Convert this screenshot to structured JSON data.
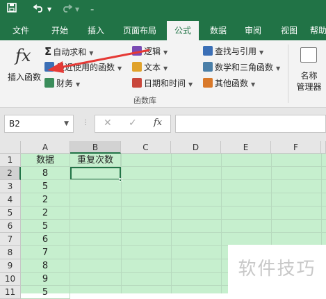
{
  "quick_access": {
    "save_icon": "save-icon",
    "undo_icon": "undo-icon",
    "redo_icon": "redo-icon",
    "customize_icon": "customize-icon"
  },
  "tabs": [
    {
      "label": "文件"
    },
    {
      "label": "开始"
    },
    {
      "label": "插入"
    },
    {
      "label": "页面布局"
    },
    {
      "label": "公式"
    },
    {
      "label": "数据"
    },
    {
      "label": "审阅"
    },
    {
      "label": "视图"
    },
    {
      "label": "帮助"
    }
  ],
  "ribbon": {
    "insert_function": {
      "icon_text": "fx",
      "label": "插入函数"
    },
    "autosum": "自动求和",
    "recent": "最近使用的函数",
    "financial": "财务",
    "logical": "逻辑",
    "text": "文本",
    "datetime": "日期和时间",
    "lookup": "查找与引用",
    "math": "数学和三角函数",
    "more": "其他函数",
    "name_manager": {
      "line1": "名称",
      "line2": "管理器"
    },
    "group_label": "函数库"
  },
  "formula_bar": {
    "name_box": "B2",
    "cancel": "✕",
    "enter": "✓",
    "fx": "fx"
  },
  "grid": {
    "columns": [
      "A",
      "B",
      "C",
      "D",
      "E",
      "F"
    ],
    "rows": [
      {
        "num": "1",
        "a": "数据",
        "b": "重复次数"
      },
      {
        "num": "2",
        "a": "8",
        "b": ""
      },
      {
        "num": "3",
        "a": "5",
        "b": ""
      },
      {
        "num": "4",
        "a": "2",
        "b": ""
      },
      {
        "num": "5",
        "a": "2",
        "b": ""
      },
      {
        "num": "6",
        "a": "5",
        "b": ""
      },
      {
        "num": "7",
        "a": "6",
        "b": ""
      },
      {
        "num": "8",
        "a": "7",
        "b": ""
      },
      {
        "num": "9",
        "a": "8",
        "b": ""
      },
      {
        "num": "10",
        "a": "9",
        "b": ""
      },
      {
        "num": "11",
        "a": "5",
        "b": ""
      }
    ]
  },
  "watermark": "软件技巧",
  "colors": {
    "brand": "#217346",
    "sheet_fill": "#c6efce",
    "arrow": "#e53935"
  }
}
